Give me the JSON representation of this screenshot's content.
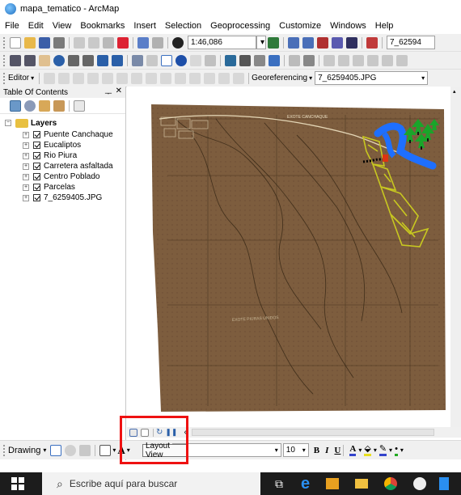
{
  "window": {
    "title": "mapa_tematico - ArcMap"
  },
  "menu": [
    "File",
    "Edit",
    "View",
    "Bookmarks",
    "Insert",
    "Selection",
    "Geoprocessing",
    "Customize",
    "Windows",
    "Help"
  ],
  "toolbar1": {
    "scale": "1:46,086",
    "layer_combo": "7_62594"
  },
  "toolbar3": {
    "editor_label": "Editor",
    "georef_label": "Georeferencing",
    "georef_layer": "7_6259405.JPG"
  },
  "toc": {
    "title": "Table Of Contents",
    "group_label": "Layers",
    "layers": [
      "Puente Canchaque",
      "Eucaliptos",
      "Rio Piura",
      "Carretera asfaltada",
      "Centro Poblado",
      "Parcelas",
      "7_6259405.JPG"
    ]
  },
  "map": {
    "road_label": "EXOTE CANCHAQUE",
    "bottom_label": "EXOTE PIURAS UNIDOS"
  },
  "drawing": {
    "label": "Drawing",
    "font_size": "10",
    "bold": "B",
    "italic": "I",
    "underline": "U",
    "tooltip": "Layout View",
    "text_tool": "A"
  },
  "taskbar": {
    "search_placeholder": "Escribe aquí para buscar"
  },
  "colors": {
    "river": "#1e6fff",
    "parcels": "#c8c820",
    "map_paper": "#7a5a3a",
    "highlight": "#ee1111"
  }
}
